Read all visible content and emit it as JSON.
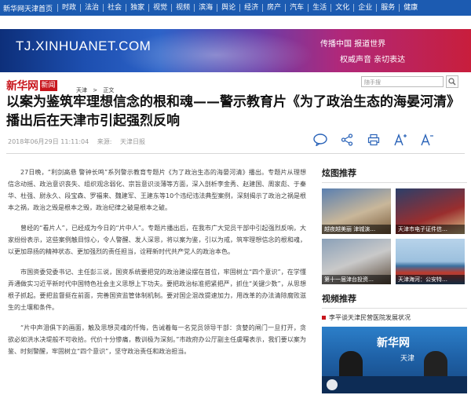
{
  "nav": {
    "home": "新华网天津首页",
    "items": [
      "时政",
      "法治",
      "社会",
      "独家",
      "视觉",
      "视频",
      "滨海",
      "舆论",
      "经济",
      "房产",
      "汽车",
      "生活",
      "文化",
      "企业",
      "服务",
      "健康"
    ]
  },
  "banner": {
    "url": "TJ.XINHUANET.COM",
    "slogan1": "传播中国  报道世界",
    "slogan2": "权威声音  亲切表达"
  },
  "logo": {
    "name": "新华网",
    "tag": "新闻"
  },
  "breadcrumb": {
    "site": "天津",
    "sep": ">",
    "section": "正文"
  },
  "search": {
    "placeholder": "随手搜"
  },
  "article": {
    "title": "以案为鉴筑牢理想信念的根和魂——警示教育片《为了政治生态的海晏河清》播出后在天津市引起强烈反响",
    "datetime": "2018年06月29日 11:11:04",
    "source_label": "来源:",
    "source": "天津日报",
    "paragraphs": [
      "27日晚，“利剑高悬 警钟长鸣”系列警示教育专题片《为了政治生态的海晏河清》播出。专题片从理想信念动摇、政治意识丧失、组织观念弱化、宗旨意识淡薄等方面，深入剖析李金秀、赵建国、周家彪、于秦华、杜强、尉永久、段宝森、罗福来、魏建军、王建东等10个违纪违法典型案例，深刻揭示了政治之祸是根本之祸，政治之毁是根本之毁，政治纪律之破是根本之破。",
      "曾经的“看片人”，已经成为今日的“片中人”。专题片播出后，在我市广大党员干部中引起强烈反响，大家纷纷表示，这些案例触目惊心，令人警醒、发人深思，将以案为鉴，引以为戒，筑牢理想信念的根和魂，以更加昂扬的精神状态、更加强烈的责任担当，诠释新时代共产党人的政治本色。",
      "市国资委党委书记、主任彭三说，国资系统要把党的政治建设摆在首位，牢固树立“四个意识”，在学懂弄通做实习近平新时代中国特色社会主义思想上下功夫。要把政治标准把紧把严，抓住“关键少数”，从思想根子抓起。要把监督挺在前面，完善国资监管体制机制。要对国企混改提速加力，用改革的办法清除腐败滋生的土壤和条件。",
      "“片中声泪俱下的画面，触及思想灵魂的忏悔，告诫着每一名党员领导干部：贪婪的闸门一旦打开，贪欲必如洪水决堤般不可收拾。代价十分惨痛，教训极为深刻。”市政府办公厅副主任虞曙表示，我们要以案为鉴、时刻警醒，牢固树立“四个意识”，坚守政治责任和政治担当。"
    ]
  },
  "sidebar": {
    "photo_title": "炫图推荐",
    "photos": [
      {
        "caption": "越夜越美丽 津城演…"
      },
      {
        "caption": "天津市电子证件信…"
      },
      {
        "caption": "第十一届津台投资…"
      },
      {
        "caption": "天津海河：公安特…"
      }
    ],
    "video_title": "视频推荐",
    "video_item": "李平谈天津民营医院发展状况",
    "video_logo": "新华网",
    "video_sub": "天津"
  },
  "colors": {
    "nav_bg": "#1c5bb1",
    "brand_red": "#c8161d",
    "icon_blue": "#2a63b8"
  }
}
